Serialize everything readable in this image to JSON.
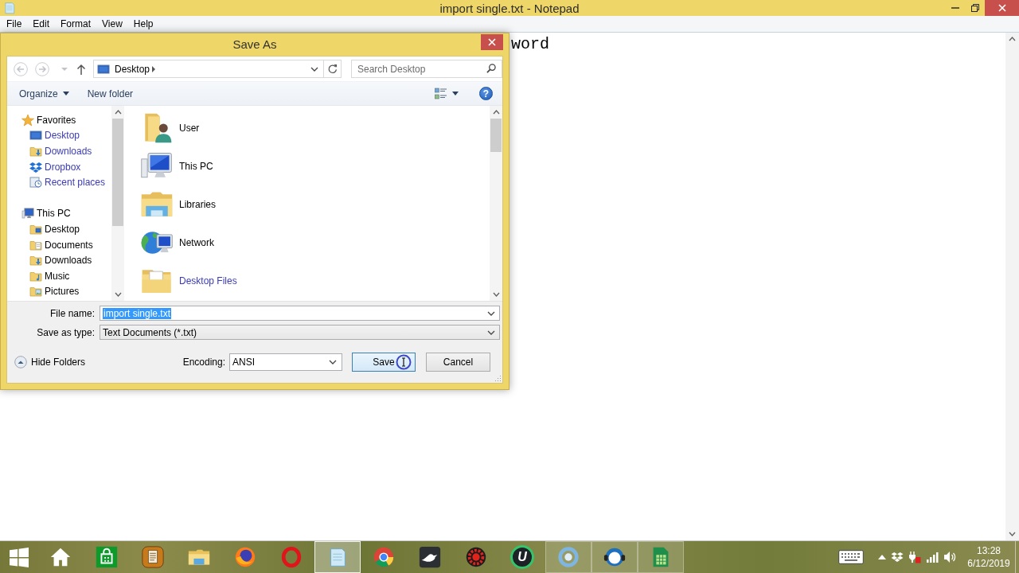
{
  "notepad": {
    "title": "import single.txt - Notepad",
    "menu": [
      "File",
      "Edit",
      "Format",
      "View",
      "Help"
    ],
    "text": "word"
  },
  "dialog": {
    "title": "Save As",
    "address": {
      "location": "Desktop"
    },
    "search": {
      "placeholder": "Search Desktop"
    },
    "toolbar": {
      "organize": "Organize",
      "new_folder": "New folder",
      "help": "?"
    },
    "navigation": [
      {
        "label": "Favorites",
        "kind": "star",
        "children": [
          {
            "label": "Desktop",
            "kind": "desktop"
          },
          {
            "label": "Downloads",
            "kind": "downloads"
          },
          {
            "label": "Dropbox",
            "kind": "dropbox"
          },
          {
            "label": "Recent places",
            "kind": "recent"
          }
        ]
      },
      {
        "label": "This PC",
        "kind": "computer",
        "children": [
          {
            "label": "Desktop",
            "kind": "desktop-folder"
          },
          {
            "label": "Documents",
            "kind": "documents"
          },
          {
            "label": "Downloads",
            "kind": "downloads"
          },
          {
            "label": "Music",
            "kind": "music"
          },
          {
            "label": "Pictures",
            "kind": "pictures"
          }
        ]
      }
    ],
    "files": [
      {
        "name": "User",
        "kind": "user-folder"
      },
      {
        "name": "This PC",
        "kind": "computer"
      },
      {
        "name": "Libraries",
        "kind": "libraries"
      },
      {
        "name": "Network",
        "kind": "network"
      },
      {
        "name": "Desktop Files",
        "kind": "folder"
      }
    ],
    "file_name": {
      "label": "File name:",
      "value": "import single.txt",
      "text_selected": true
    },
    "save_as_type": {
      "label": "Save as type:",
      "value": "Text Documents (*.txt)"
    },
    "hide_folders": "Hide Folders",
    "encoding": {
      "label": "Encoding:",
      "value": "ANSI"
    },
    "buttons": [
      {
        "label": "Save",
        "kind": "default"
      },
      {
        "label": "Cancel",
        "kind": "normal"
      }
    ]
  },
  "taskbar": {
    "apps": [
      {
        "kind": "home",
        "selected": false,
        "running": false
      },
      {
        "kind": "store",
        "selected": false,
        "running": false
      },
      {
        "kind": "document-stack",
        "selected": false,
        "running": false
      },
      {
        "kind": "folder",
        "selected": false,
        "running": false
      },
      {
        "kind": "globe",
        "selected": false,
        "running": false
      },
      {
        "kind": "bold-ring",
        "selected": false,
        "running": false
      },
      {
        "kind": "notepad",
        "selected": true,
        "running": true
      },
      {
        "kind": "wheel",
        "selected": false,
        "running": false
      },
      {
        "kind": "bird",
        "selected": false,
        "running": false
      },
      {
        "kind": "gear",
        "selected": false,
        "running": false
      },
      {
        "kind": "letter-badge",
        "glyph": "U",
        "selected": false,
        "running": false
      },
      {
        "kind": "soft-ring",
        "selected": false,
        "running": true
      },
      {
        "kind": "headset",
        "selected": false,
        "running": true
      },
      {
        "kind": "spreadsheet",
        "selected": false,
        "running": true
      }
    ],
    "clock": {
      "time": "13:28",
      "date": "6/12/2019"
    }
  }
}
